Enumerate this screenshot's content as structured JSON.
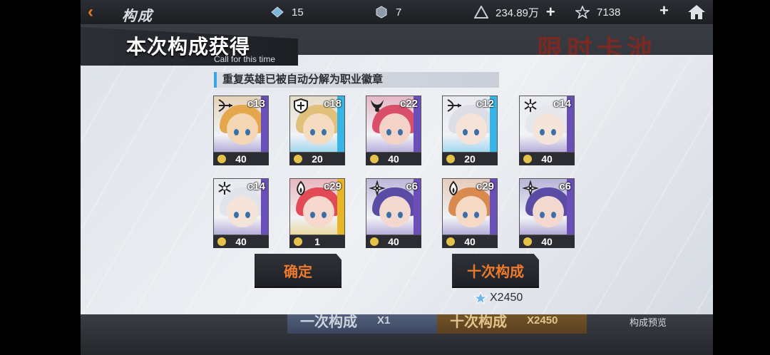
{
  "topbar": {
    "title": "构成",
    "res1": "15",
    "res2": "7",
    "res3": "234.89万",
    "res4": "7138"
  },
  "background": {
    "deco_text": "限时卡池",
    "bottom_btn1": "一次构成",
    "bottom_btn1_cost": "X1",
    "bottom_btn2": "十次构成",
    "bottom_btn2_cost": "X2450",
    "preview_label": "构成预览"
  },
  "modal": {
    "title": "本次构成获得",
    "subtitle": "Call for this time",
    "notice": "重复英雄已被自动分解为职业徽章",
    "confirm_label": "确定",
    "ten_label": "十次构成",
    "cost": "X2450"
  },
  "cards": [
    {
      "count": "c13",
      "badge": "40",
      "class": "bow-icon",
      "stripe": "#6b4fb8",
      "hair": "#e5a74d",
      "skin": "#f4d6b5"
    },
    {
      "count": "c18",
      "badge": "20",
      "class": "shield-icon",
      "stripe": "#36b6e8",
      "hair": "#e0c07a",
      "skin": "#f5dcc0"
    },
    {
      "count": "c22",
      "badge": "40",
      "class": "horns-icon",
      "stripe": "#6b4fb8",
      "hair": "#d94e6a",
      "skin": "#f3d2c8"
    },
    {
      "count": "c12",
      "badge": "20",
      "class": "bow-icon",
      "stripe": "#36b6e8",
      "hair": "#dcdde6",
      "skin": "#f5e2d8"
    },
    {
      "count": "c14",
      "badge": "40",
      "class": "snowflake-icon",
      "stripe": "#6b4fb8",
      "hair": "#e6e8ee",
      "skin": "#f5e4da"
    },
    {
      "count": "c14",
      "badge": "40",
      "class": "snowflake-icon",
      "stripe": "#6b4fb8",
      "hair": "#e2e4ec",
      "skin": "#f5e4da"
    },
    {
      "count": "c29",
      "badge": "1",
      "class": "flame-icon",
      "stripe": "#e8b526",
      "hair": "#e24a55",
      "skin": "#f6d8cf"
    },
    {
      "count": "c6",
      "badge": "40",
      "class": "shuriken-icon",
      "stripe": "#6b4fb8",
      "hair": "#5a4ba5",
      "skin": "#f2d8cf"
    },
    {
      "count": "c29",
      "badge": "40",
      "class": "flame-icon",
      "stripe": "#6b4fb8",
      "hair": "#d98a4f",
      "skin": "#f6dac6"
    },
    {
      "count": "c6",
      "badge": "40",
      "class": "shuriken-icon",
      "stripe": "#6b4fb8",
      "hair": "#5a4ba5",
      "skin": "#f2d8cf"
    }
  ]
}
